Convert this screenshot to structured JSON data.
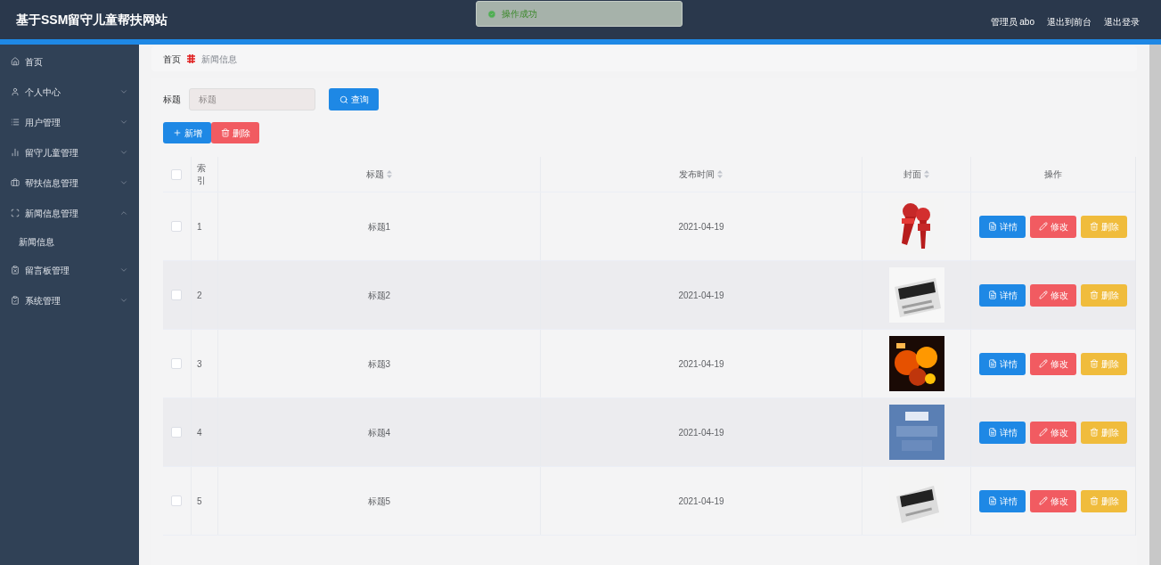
{
  "header": {
    "title": "基于SSM留守儿童帮扶网站",
    "links": [
      "管理员 abo",
      "退出到前台",
      "退出登录"
    ]
  },
  "toast": {
    "message": "操作成功"
  },
  "sidebar": {
    "items": [
      {
        "label": "首页",
        "expandable": false
      },
      {
        "label": "个人中心",
        "expandable": true,
        "expanded": false
      },
      {
        "label": "用户管理",
        "expandable": true,
        "expanded": false
      },
      {
        "label": "留守儿童管理",
        "expandable": true,
        "expanded": false
      },
      {
        "label": "帮扶信息管理",
        "expandable": true,
        "expanded": false
      },
      {
        "label": "新闻信息管理",
        "expandable": true,
        "expanded": true,
        "children": [
          {
            "label": "新闻信息"
          }
        ]
      },
      {
        "label": "留言板管理",
        "expandable": true,
        "expanded": false
      },
      {
        "label": "系统管理",
        "expandable": true,
        "expanded": false
      }
    ]
  },
  "breadcrumb": [
    "首页",
    "新闻信息"
  ],
  "search": {
    "label": "标题",
    "placeholder": "标题",
    "button": "查询"
  },
  "actions": [
    "新增",
    "删除"
  ],
  "table": {
    "select_all_checked": false,
    "columns": [
      {
        "label": "索引",
        "sortable": false
      },
      {
        "label": "标题",
        "sortable": true
      },
      {
        "label": "发布时间",
        "sortable": true
      },
      {
        "label": "封面",
        "sortable": true
      },
      {
        "label": "操作",
        "sortable": false
      }
    ],
    "rows": [
      {
        "index": "1",
        "title": "标题1",
        "date": "2021-04-19",
        "checked": false,
        "buttons": [
          "详情",
          "修改",
          "删除"
        ]
      },
      {
        "index": "2",
        "title": "标题2",
        "date": "2021-04-19",
        "checked": false,
        "buttons": [
          "详情",
          "修改",
          "删除"
        ]
      },
      {
        "index": "3",
        "title": "标题3",
        "date": "2021-04-19",
        "checked": false,
        "buttons": [
          "详情",
          "修改",
          "删除"
        ]
      },
      {
        "index": "4",
        "title": "标题4",
        "date": "2021-04-19",
        "checked": false,
        "buttons": [
          "详情",
          "修改",
          "删除"
        ]
      },
      {
        "index": "5",
        "title": "标题5",
        "date": "2021-04-19",
        "checked": false,
        "buttons": [
          "详情",
          "修改",
          "删除"
        ]
      }
    ]
  }
}
